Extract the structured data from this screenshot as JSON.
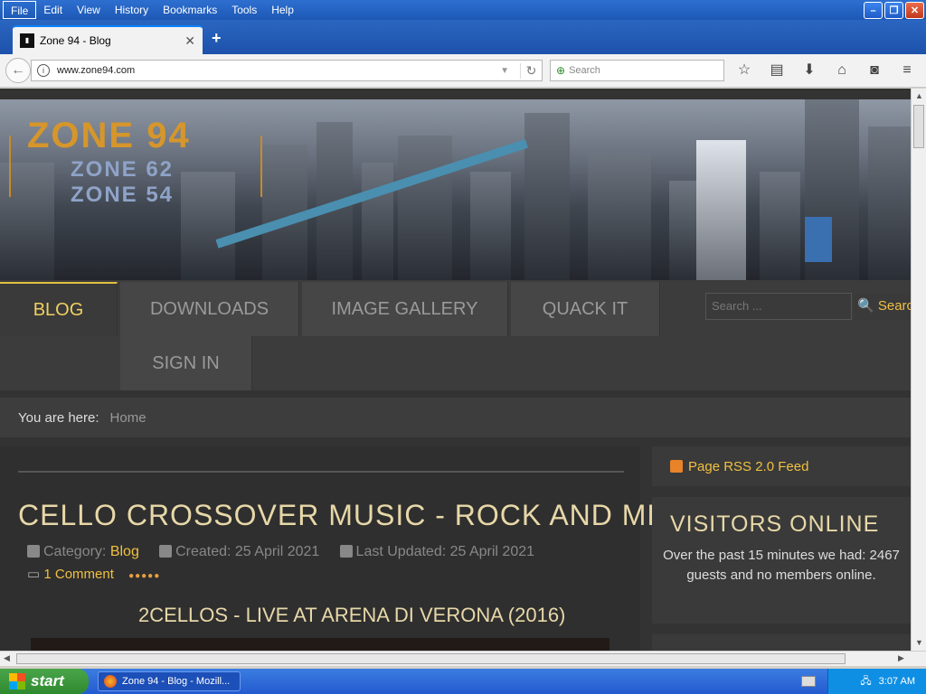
{
  "menubar": {
    "items": [
      "File",
      "Edit",
      "View",
      "History",
      "Bookmarks",
      "Tools",
      "Help"
    ]
  },
  "browser": {
    "tab_title": "Zone 94 - Blog",
    "url": "www.zone94.com",
    "search_placeholder": "Search"
  },
  "site": {
    "logo": {
      "main": "ZONE 94",
      "sub1": "ZONE 62",
      "sub2": "ZONE 54"
    },
    "nav": [
      "BLOG",
      "DOWNLOADS",
      "IMAGE GALLERY",
      "QUACK IT",
      "SIGN IN"
    ],
    "search_placeholder": "Search ...",
    "search_button": "Search",
    "breadcrumb": {
      "label": "You are here:",
      "home": "Home"
    },
    "article": {
      "title": "CELLO CROSSOVER MUSIC - ROCK AND METAL",
      "category_label": "Category:",
      "category": "Blog",
      "created": "Created: 25 April 2021",
      "updated": "Last Updated: 25 April 2021",
      "comments": "1 Comment",
      "subtitle": "2CELLOS - LIVE AT ARENA DI VERONA (2016)"
    },
    "sidebar": {
      "rss": "Page RSS 2.0 Feed",
      "visitors_title": "VISITORS ONLINE",
      "visitors_text": "Over the past 15 minutes we had: 2467 guests and no members online."
    }
  },
  "taskbar": {
    "start": "start",
    "task": "Zone 94 - Blog - Mozill...",
    "time": "3:07 AM"
  }
}
